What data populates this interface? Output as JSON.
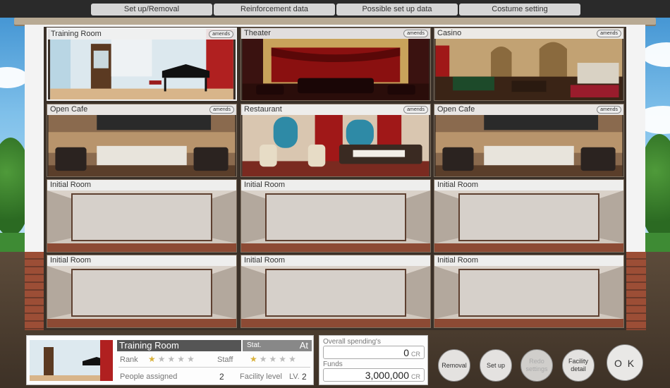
{
  "tabs": [
    "Set up/Removal",
    "Reinforcement data",
    "Possible set up data",
    "Costume setting"
  ],
  "rooms": [
    {
      "label": "Training Room",
      "amends": "amends"
    },
    {
      "label": "Theater",
      "amends": "amends"
    },
    {
      "label": "Casino",
      "amends": "amends"
    },
    {
      "label": "Open Cafe",
      "amends": "amends"
    },
    {
      "label": "Restaurant",
      "amends": "amends"
    },
    {
      "label": "Open Cafe",
      "amends": "amends"
    },
    {
      "label": "Initial Room"
    },
    {
      "label": "Initial Room"
    },
    {
      "label": "Initial Room"
    },
    {
      "label": "Initial Room"
    },
    {
      "label": "Initial Room"
    },
    {
      "label": "Initial Room"
    }
  ],
  "info": {
    "title": "Training Room",
    "stat_label": "Stat.",
    "stat_value": "At",
    "rank_label": "Rank",
    "staff_label": "Staff",
    "rank_stars": 1,
    "staff_stars": 1,
    "max_stars": 5,
    "people_label": "People assigned",
    "people_value": "2",
    "level_label": "Facility level",
    "lv_prefix": "LV.",
    "level_value": "2"
  },
  "funds": {
    "spending_label": "Overall spending's",
    "spending_value": "0",
    "funds_label": "Funds",
    "funds_value": "3,000,000",
    "unit": "CR"
  },
  "buttons": {
    "removal": "Removal",
    "setup": "Set up",
    "redo": "Redo settings",
    "facility": "Facility detail",
    "ok": "O K"
  }
}
